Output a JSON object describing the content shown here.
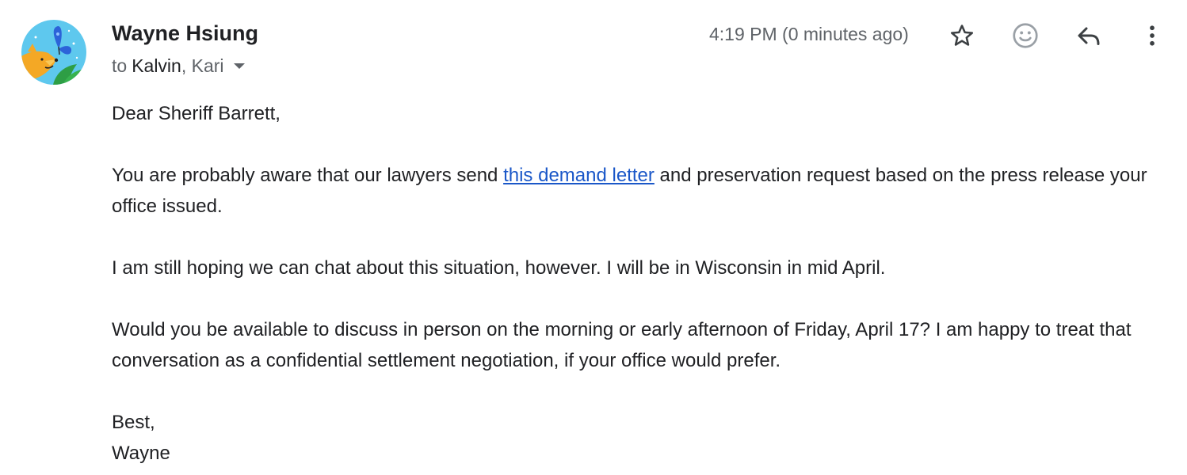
{
  "header": {
    "sender_name": "Wayne Hsiung",
    "to_prefix": "to",
    "recipient_1": "Kalvin",
    "recipient_separator": ",",
    "recipient_2": "Kari",
    "timestamp": "4:19 PM (0 minutes ago)"
  },
  "actions": {
    "star_icon": "star-outline-icon",
    "emoji_icon": "smiley-icon",
    "reply_icon": "reply-arrow-icon",
    "more_icon": "more-vertical-icon"
  },
  "message": {
    "greeting": "Dear Sheriff Barrett,",
    "para1_before": "You are probably aware that our lawyers send ",
    "para1_link": "this demand letter",
    "para1_after": " and preservation request based on the press release your office issued.",
    "para2": "I am still hoping we can chat about this situation, however. I will be in Wisconsin in mid April.",
    "para3": "Would you be available to discuss in person on the morning or early afternoon of Friday, April 17? I am happy to treat that conversation as a confidential settlement negotiation, if your office would prefer.",
    "signoff": "Best,",
    "signature": "Wayne"
  },
  "colors": {
    "link": "#1a57c8",
    "text": "#202124",
    "muted": "#5f6368",
    "avatar_bg": "#5ec8ee"
  }
}
